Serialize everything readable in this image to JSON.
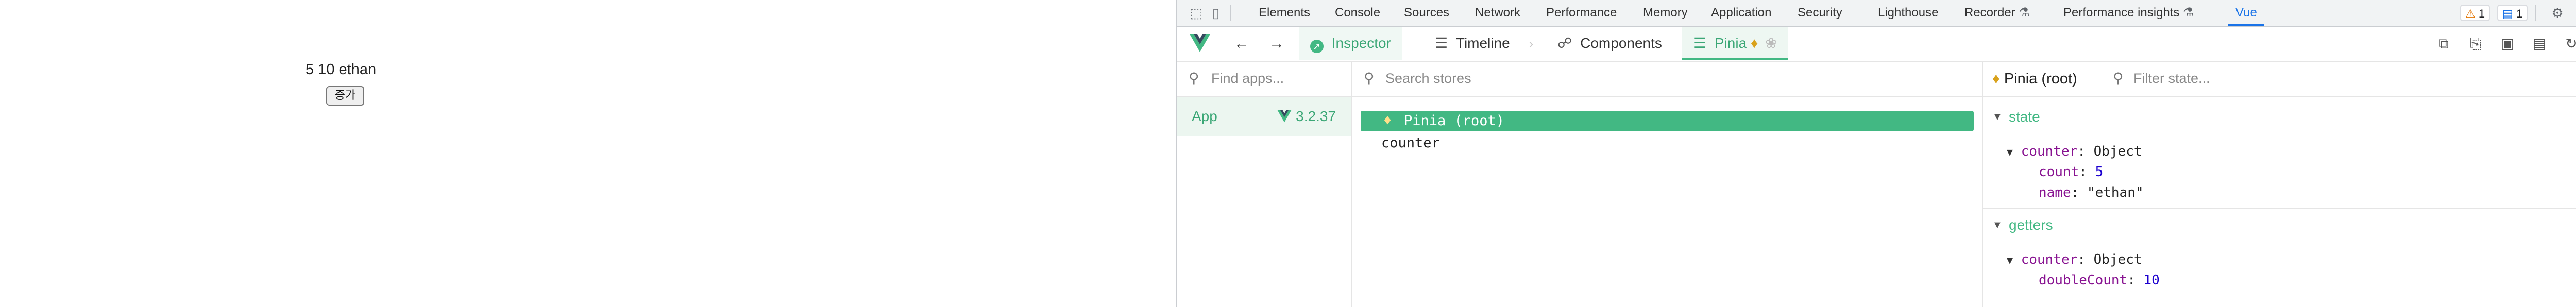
{
  "page": {
    "text": "5 10 ethan",
    "button_label": "증가"
  },
  "devtools": {
    "tabs": [
      "Elements",
      "Console",
      "Sources",
      "Network",
      "Performance",
      "Memory",
      "Application",
      "Security",
      "Lighthouse",
      "Recorder",
      "Performance insights",
      "Vue"
    ],
    "active_tab": "Vue",
    "warnings_count": "1",
    "messages_count": "1"
  },
  "vue_toolbar": {
    "inspector_label": "Inspector",
    "timeline_label": "Timeline",
    "components_label": "Components",
    "pinia_label": "Pinia",
    "accent": "#42b883"
  },
  "apps_pane": {
    "search_placeholder": "Find apps...",
    "app_name": "App",
    "app_version": "3.2.37"
  },
  "stores_pane": {
    "search_placeholder": "Search stores",
    "stores": [
      "Pinia (root)",
      "counter"
    ]
  },
  "state_pane": {
    "title": "Pinia (root)",
    "filter_placeholder": "Filter state...",
    "state_section": "state",
    "state_obj_key": "counter",
    "state_obj_type": "Object",
    "count_key": "count",
    "count_val": "5",
    "name_key": "name",
    "name_val": "\"ethan\"",
    "getters_section": "getters",
    "getters_obj_key": "counter",
    "getters_obj_type": "Object",
    "double_key": "doubleCount",
    "double_val": "10"
  }
}
